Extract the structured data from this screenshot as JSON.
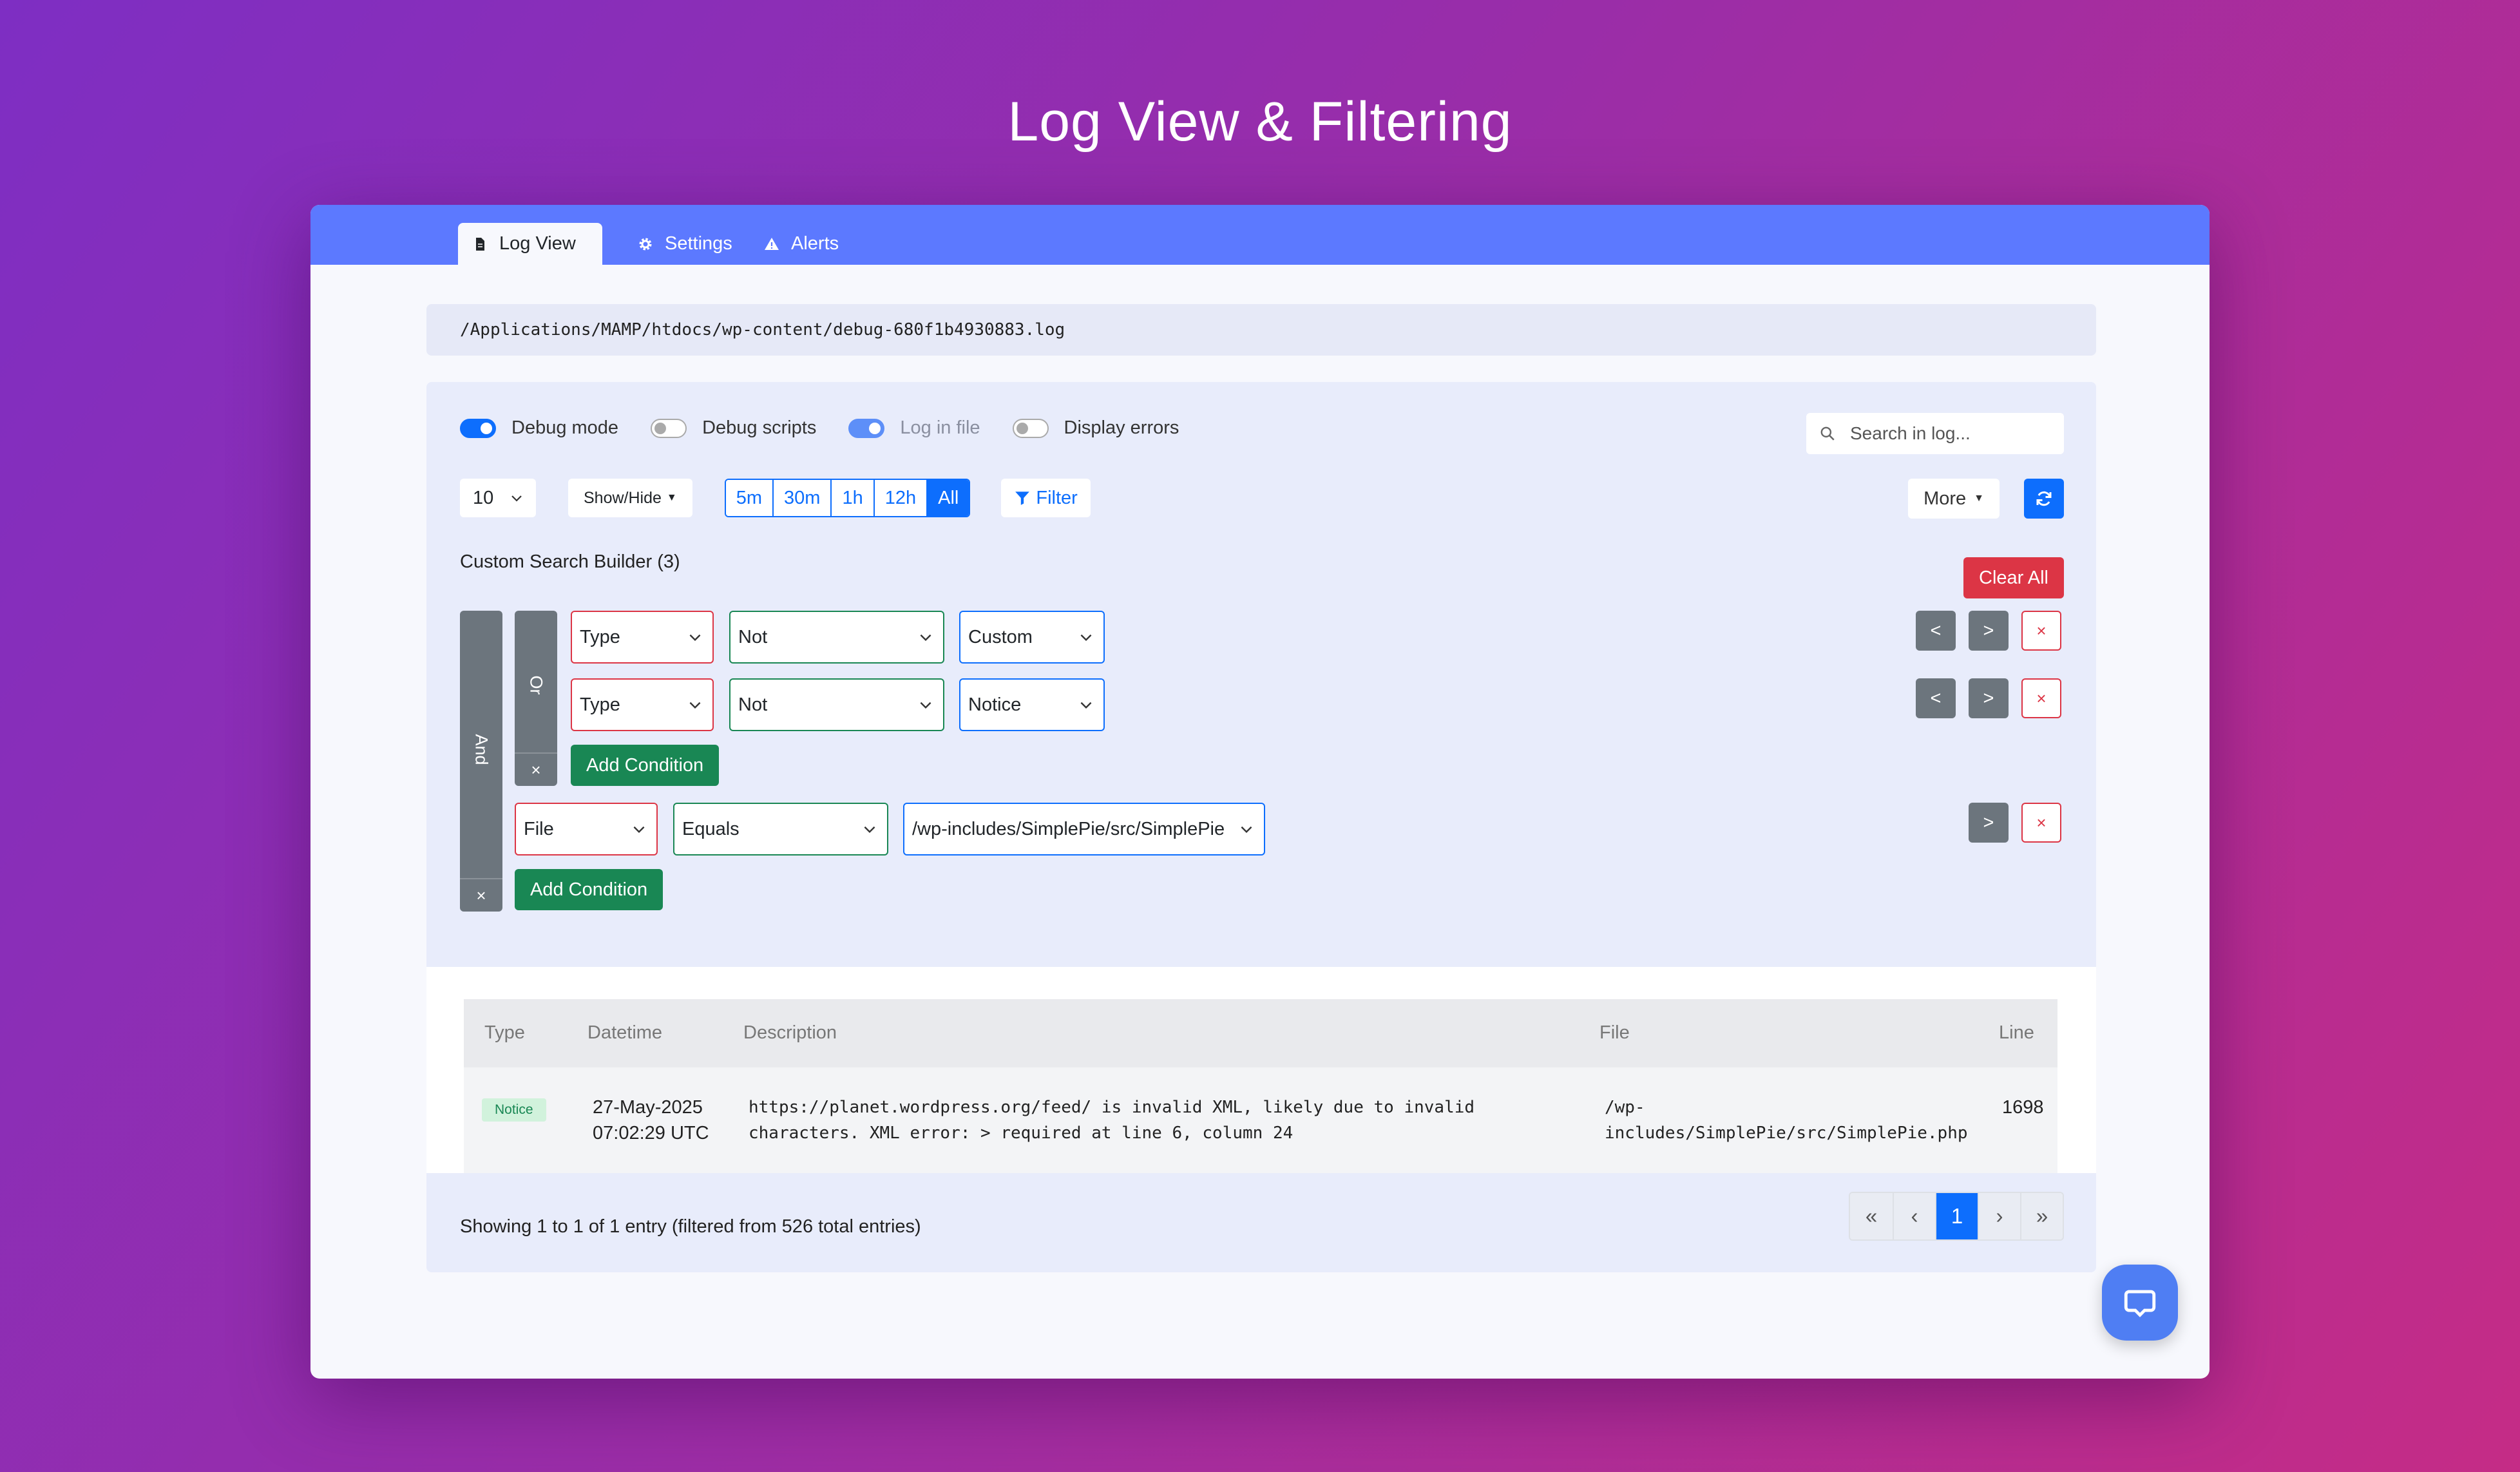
{
  "hero_title": "Log View & Filtering",
  "tabs": [
    {
      "label": "Log View",
      "icon": "file-icon",
      "active": true
    },
    {
      "label": "Settings",
      "icon": "gear-icon",
      "active": false
    },
    {
      "label": "Alerts",
      "icon": "warning-icon",
      "active": false
    }
  ],
  "log_path": "/Applications/MAMP/htdocs/wp-content/debug-680f1b4930883.log",
  "toggles": [
    {
      "label": "Debug mode",
      "on": true
    },
    {
      "label": "Debug scripts",
      "on": false
    },
    {
      "label": "Log in file",
      "on": true,
      "disabled": true
    },
    {
      "label": "Display errors",
      "on": false
    }
  ],
  "search": {
    "placeholder": "Search in log..."
  },
  "toolbar": {
    "page_length": "10",
    "show_hide_label": "Show/Hide",
    "time_ranges": [
      "5m",
      "30m",
      "1h",
      "12h",
      "All"
    ],
    "time_range_active": "All",
    "filter_label": "Filter",
    "more_label": "More"
  },
  "builder": {
    "title": "Custom Search Builder (3)",
    "clear_all_label": "Clear All",
    "and_label": "And",
    "or_label": "Or",
    "close_symbol": "×",
    "add_condition_label": "Add Condition",
    "left_symbol": "<",
    "right_symbol": ">",
    "conditions": [
      {
        "field": "Type",
        "operator": "Not",
        "value": "Custom"
      },
      {
        "field": "Type",
        "operator": "Not",
        "value": "Notice"
      },
      {
        "field": "File",
        "operator": "Equals",
        "value": "/wp-includes/SimplePie/src/SimplePie"
      }
    ]
  },
  "table": {
    "columns": [
      "Type",
      "Datetime",
      "Description",
      "File",
      "Line"
    ],
    "rows": [
      {
        "type": "Notice",
        "datetime_date": "27-May-2025",
        "datetime_time": "07:02:29 UTC",
        "description_line1": "https://planet.wordpress.org/feed/ is invalid XML, likely due to invalid",
        "description_line2": "characters. XML error: > required at line 6, column 24",
        "file_line1": "/wp-",
        "file_line2": "includes/SimplePie/src/SimplePie.php",
        "line": "1698"
      }
    ]
  },
  "footer": {
    "info": "Showing 1 to 1 of 1 entry (filtered from 526 total entries)",
    "pager": {
      "first": "«",
      "prev": "‹",
      "current": "1",
      "next": "›",
      "last": "»"
    }
  },
  "colors": {
    "accent": "#0d6efd",
    "tabbar": "#5c79ff",
    "danger": "#dc3545",
    "success": "#198754"
  }
}
